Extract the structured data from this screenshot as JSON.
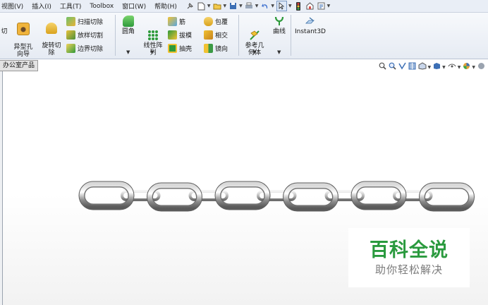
{
  "menubar": {
    "items": [
      "视图(V)",
      "插入(I)",
      "工具(T)",
      "Toolbox",
      "窗口(W)",
      "帮助(H)"
    ]
  },
  "ribbon": {
    "cut_label": "切",
    "hole_wizard": "异型孔\n向导",
    "revolve_cut": "旋转切\n除",
    "sweep_cut": "扫描切除",
    "loft_cut": "放样切割",
    "boundary_cut": "边界切除",
    "fillet": "圆角",
    "linear_pattern": "线性阵\n列",
    "rib": "筋",
    "draft": "拔模",
    "shell": "抽壳",
    "wrap": "包覆",
    "intersect": "相交",
    "mirror": "镜向",
    "reference_geometry": "参考几\n何体",
    "curves": "曲线",
    "instant3d": "Instant3D"
  },
  "feature_tree": {
    "tab_label": "办公室产品"
  },
  "model": {
    "description_links": 6
  },
  "watermark": {
    "title": "百科全说",
    "subtitle": "助你轻松解决"
  },
  "colors": {
    "watermark_green": "#2a9a3e",
    "chain_steel": "#9a9a9a"
  }
}
